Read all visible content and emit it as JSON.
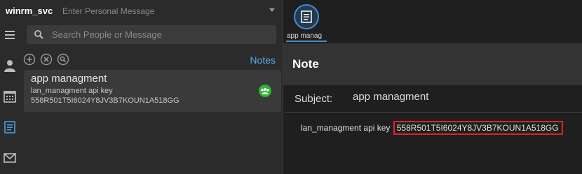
{
  "header": {
    "username": "winrm_svc",
    "personal_message_placeholder": "Enter Personal Message"
  },
  "search": {
    "placeholder": "Search People or Message"
  },
  "notes_toolbar": {
    "notes_label": "Notes"
  },
  "note_list": [
    {
      "title": "app managment",
      "line1": "lan_managment  api key",
      "line2": "558R501T5I6024Y8JV3B7KOUN1A518GG",
      "shared_icon": "group-share-icon"
    }
  ],
  "viewer": {
    "tab_label": "app manag",
    "heading": "Note",
    "subject_label": "Subject:",
    "subject_value": "app managment",
    "body_prefix": "lan_managment  api key ",
    "body_key": "558R501T5I6024Y8JV3B7KOUN1A518GG"
  },
  "colors": {
    "accent": "#3e8fd6",
    "link": "#5aa9e6",
    "highlight_border": "#e0241f",
    "share_green": "#2fb52f"
  }
}
